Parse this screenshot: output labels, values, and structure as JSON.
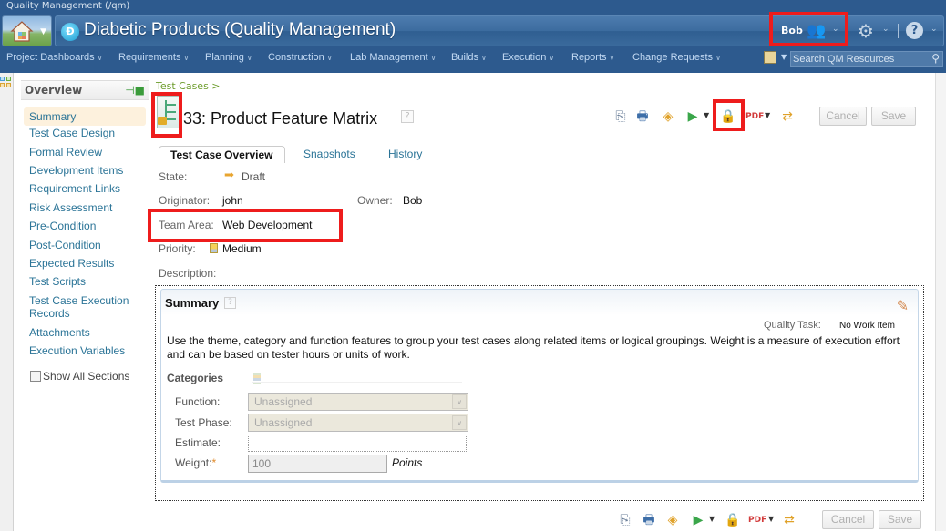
{
  "window": {
    "app_title": "Quality Management (/qm)"
  },
  "header": {
    "project_title": "Diabetic Products (Quality Management)",
    "project_logo_letter": "Ð",
    "user_name": "Bob"
  },
  "nav": {
    "items": [
      {
        "label": "Project Dashboards"
      },
      {
        "label": "Requirements"
      },
      {
        "label": "Planning"
      },
      {
        "label": "Construction"
      },
      {
        "label": "Lab Management"
      },
      {
        "label": "Builds"
      },
      {
        "label": "Execution"
      },
      {
        "label": "Reports"
      },
      {
        "label": "Change Requests"
      }
    ],
    "search_placeholder": "Search QM Resources"
  },
  "sidebar": {
    "title": "Overview",
    "items": [
      {
        "label": "Summary",
        "active": true
      },
      {
        "label": "Test Case Design"
      },
      {
        "label": "Formal Review"
      },
      {
        "label": "Development Items"
      },
      {
        "label": "Requirement Links"
      },
      {
        "label": "Risk Assessment"
      },
      {
        "label": "Pre-Condition"
      },
      {
        "label": "Post-Condition"
      },
      {
        "label": "Expected Results"
      },
      {
        "label": "Test Scripts"
      },
      {
        "label": "Test Case Execution Records"
      },
      {
        "label": "Attachments"
      },
      {
        "label": "Execution Variables"
      }
    ],
    "show_all_label": "Show All Sections"
  },
  "main": {
    "breadcrumb": "Test Cases >",
    "title": "33: Product Feature Matrix",
    "toolbar": {
      "cancel_label": "Cancel",
      "save_label": "Save"
    },
    "tabs": [
      {
        "label": "Test Case Overview",
        "active": true
      },
      {
        "label": "Snapshots"
      },
      {
        "label": "History"
      }
    ],
    "fields": {
      "state_label": "State:",
      "state_value": "Draft",
      "originator_label": "Originator:",
      "originator_value": "john",
      "owner_label": "Owner:",
      "owner_value": "Bob",
      "team_area_label": "Team Area:",
      "team_area_value": "Web Development",
      "priority_label": "Priority:",
      "priority_value": "Medium",
      "description_label": "Description:"
    },
    "summary": {
      "title": "Summary",
      "quality_task_label": "Quality Task:",
      "quality_task_value": "No Work Item",
      "description": "Use the theme, category and function features to group your test cases along related items or logical groupings. Weight is a measure of execution effort and can be based on tester hours or units of work.",
      "categories_title": "Categories",
      "function_label": "Function:",
      "function_value": "Unassigned",
      "test_phase_label": "Test Phase:",
      "test_phase_value": "Unassigned",
      "estimate_label": "Estimate:",
      "estimate_value": "",
      "weight_label": "Weight:",
      "weight_value": "100",
      "weight_unit": "Points"
    }
  },
  "colors": {
    "header_bg": "#2d5a8e",
    "link": "#2b7497",
    "breadcrumb": "#6c9c2b",
    "highlight_box": "#ee1c1c"
  }
}
